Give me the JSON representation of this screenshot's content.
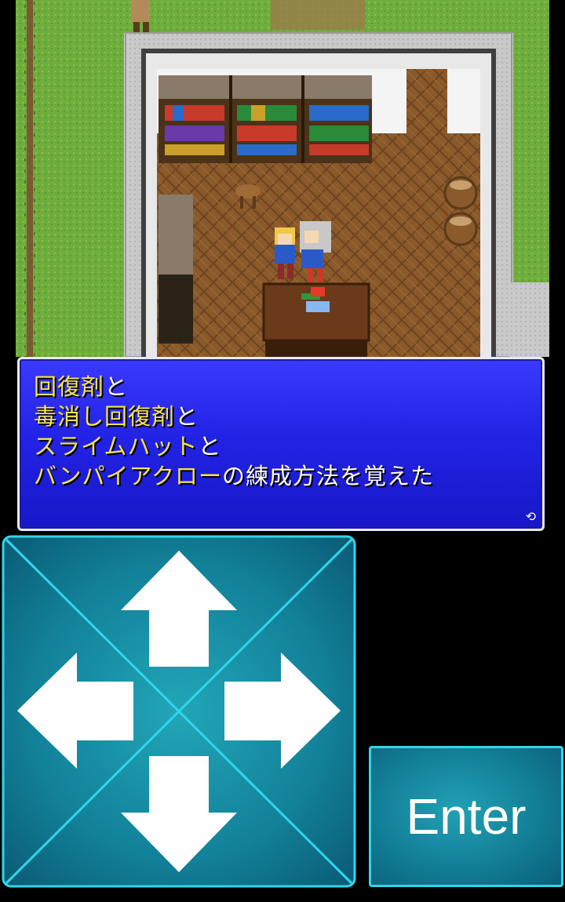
{
  "dialog": {
    "lines": [
      {
        "highlight": "回復剤",
        "rest": "と"
      },
      {
        "highlight": "毒消し回復剤",
        "rest": "と"
      },
      {
        "highlight": "スライムハット",
        "rest": "と"
      },
      {
        "highlight": "バンパイアクロー",
        "rest": "の練成方法を覚えた"
      }
    ],
    "more_icon": "⟲",
    "highlight_color": "#f6e44a",
    "background_color": "#2323e6"
  },
  "controls": {
    "dpad_icons": [
      "arrow-up-icon",
      "arrow-down-icon",
      "arrow-left-icon",
      "arrow-right-icon"
    ],
    "enter_label": "Enter",
    "accent_color": "#2fd6ea",
    "panel_color": "#127e97"
  },
  "scene": {
    "grass_color": "#6fae3c",
    "floor_color": "#8a5a2b",
    "wall_color": "#c9c9c9"
  }
}
